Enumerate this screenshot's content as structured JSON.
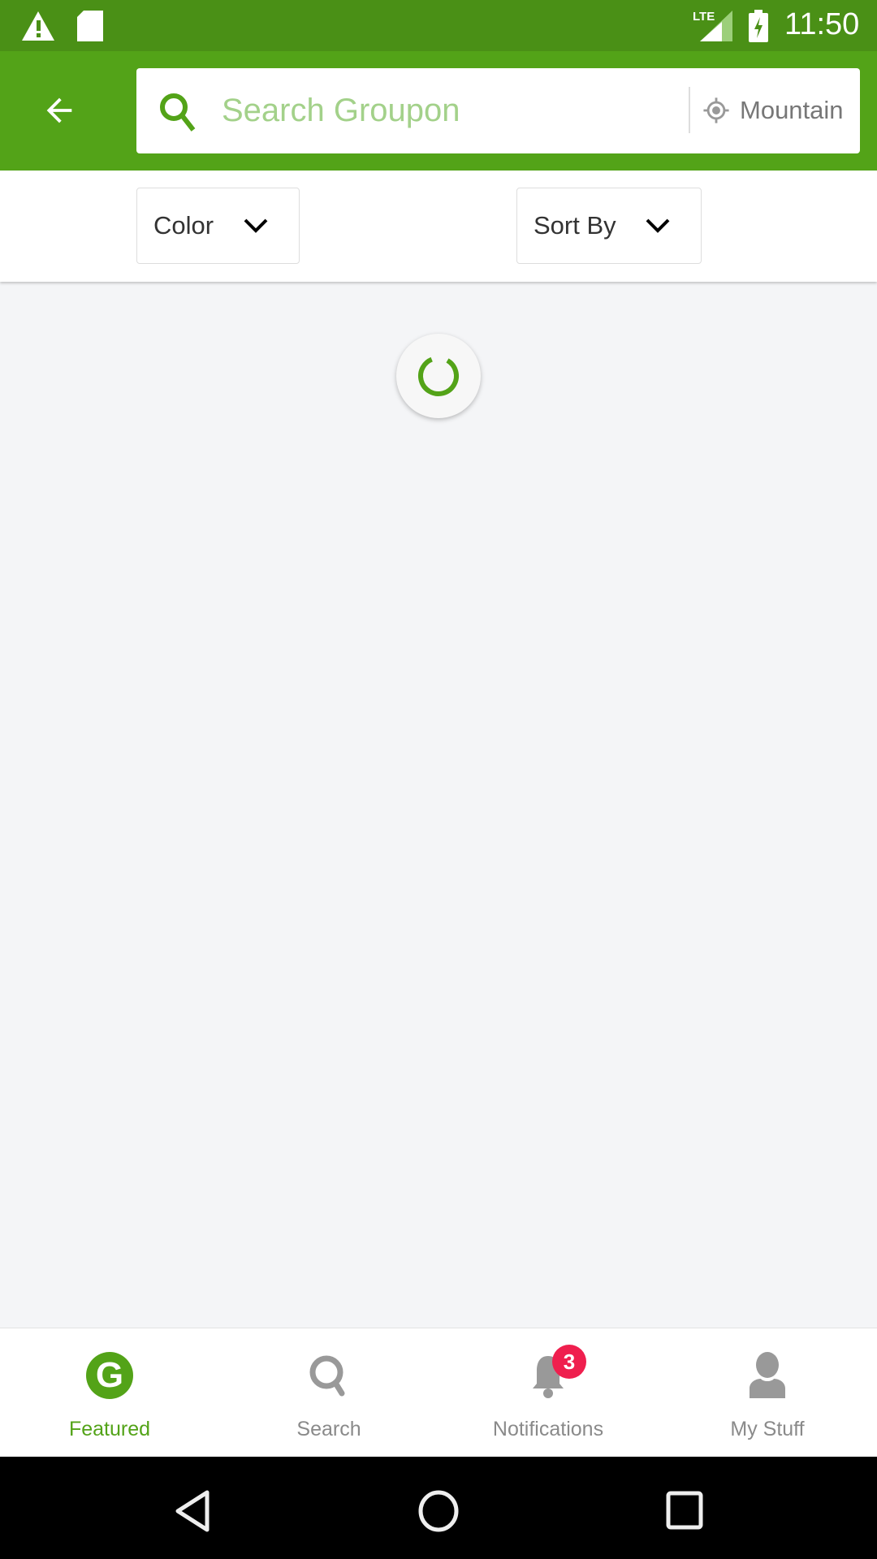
{
  "status_bar": {
    "time": "11:50",
    "network": "LTE"
  },
  "search": {
    "placeholder": "Search Groupon",
    "location": "Mountain"
  },
  "filters": {
    "color_label": "Color",
    "sort_label": "Sort By"
  },
  "bottom_nav": {
    "tabs": [
      {
        "label": "Featured",
        "active": true
      },
      {
        "label": "Search"
      },
      {
        "label": "Notifications",
        "badge": "3"
      },
      {
        "label": "My Stuff"
      }
    ]
  },
  "colors": {
    "brand": "#53a318",
    "status": "#4a9016",
    "badge": "#ef1f4e",
    "inactive": "#8a8a8a"
  }
}
